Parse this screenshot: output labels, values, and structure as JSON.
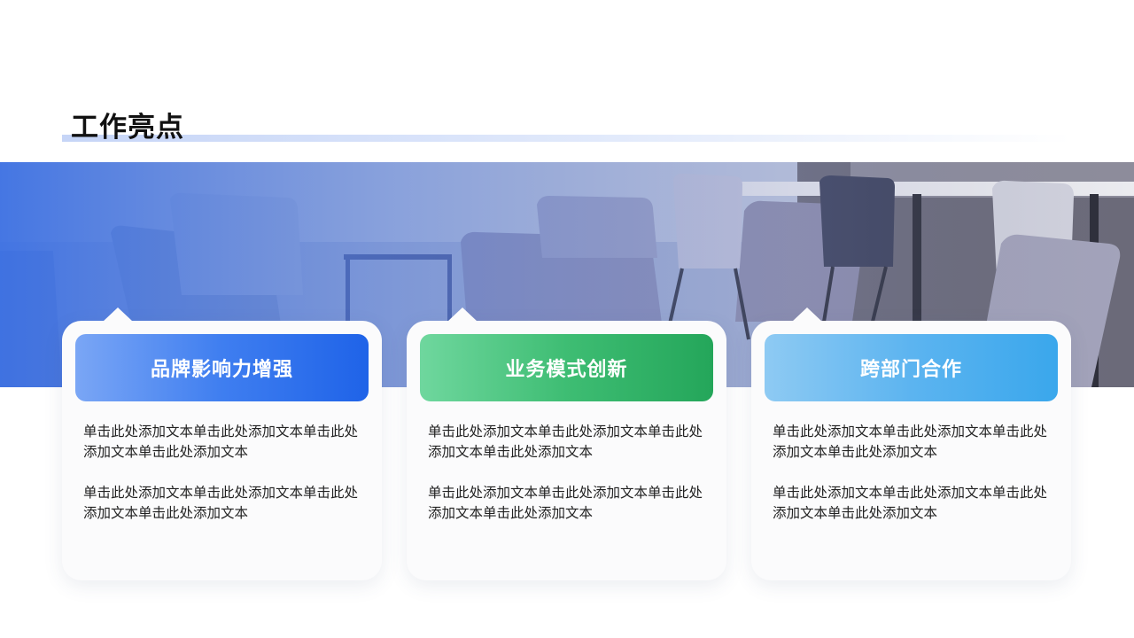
{
  "page": {
    "title": "工作亮点"
  },
  "colors": {
    "band_overlay": "#3f73e6",
    "card_blue": "#2d6ff0",
    "card_green": "#2fb065",
    "card_sky": "#47aef0",
    "card_bg": "#fbfbfc"
  },
  "cards": [
    {
      "title": "品牌影响力增强",
      "paragraphs": [
        "单击此处添加文本单击此处添加文本单击此处添加文本单击此处添加文本",
        "单击此处添加文本单击此处添加文本单击此处添加文本单击此处添加文本"
      ]
    },
    {
      "title": "业务模式创新",
      "paragraphs": [
        "单击此处添加文本单击此处添加文本单击此处添加文本单击此处添加文本",
        "单击此处添加文本单击此处添加文本单击此处添加文本单击此处添加文本"
      ]
    },
    {
      "title": "跨部门合作",
      "paragraphs": [
        "单击此处添加文本单击此处添加文本单击此处添加文本单击此处添加文本",
        "单击此处添加文本单击此处添加文本单击此处添加文本单击此处添加文本"
      ]
    }
  ]
}
